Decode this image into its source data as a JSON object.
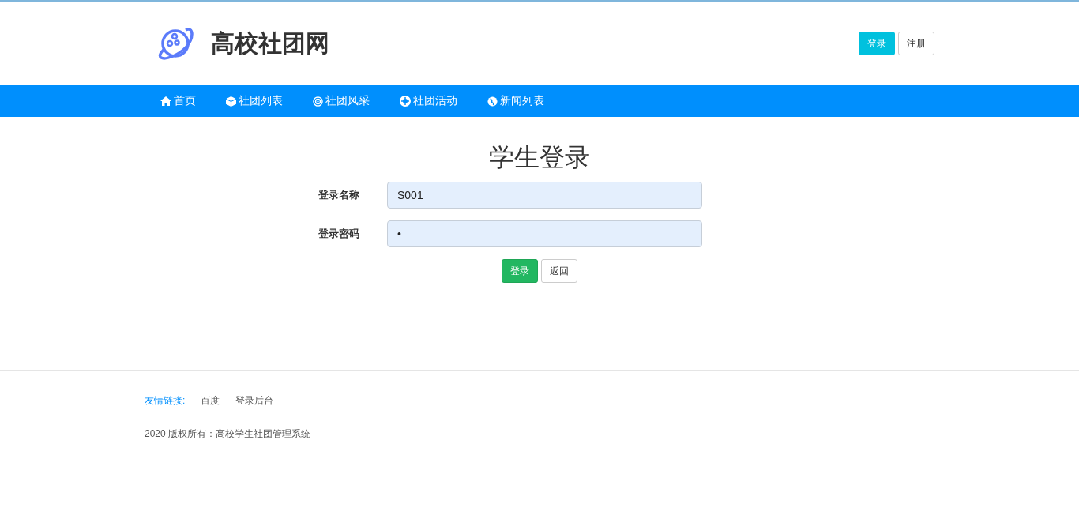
{
  "site": {
    "title": "高校社团网"
  },
  "header_buttons": [
    {
      "label": "登录",
      "kind": "primary"
    },
    {
      "label": "注册",
      "kind": "default"
    }
  ],
  "nav": [
    {
      "label": "首页"
    },
    {
      "label": "社团列表"
    },
    {
      "label": "社团风采"
    },
    {
      "label": "社团活动"
    },
    {
      "label": "新闻列表"
    }
  ],
  "form": {
    "title": "学生登录",
    "fields": [
      {
        "label": "登录名称",
        "value": "S001"
      },
      {
        "label": "登录密码",
        "value": "•"
      }
    ],
    "buttons": [
      {
        "label": "登录",
        "kind": "success"
      },
      {
        "label": "返回",
        "kind": "default"
      }
    ]
  },
  "footer": {
    "links_label": "友情链接:",
    "links": [
      "百度",
      "登录后台"
    ],
    "copyright": "2020 版权所有：高校学生社团管理系统"
  }
}
